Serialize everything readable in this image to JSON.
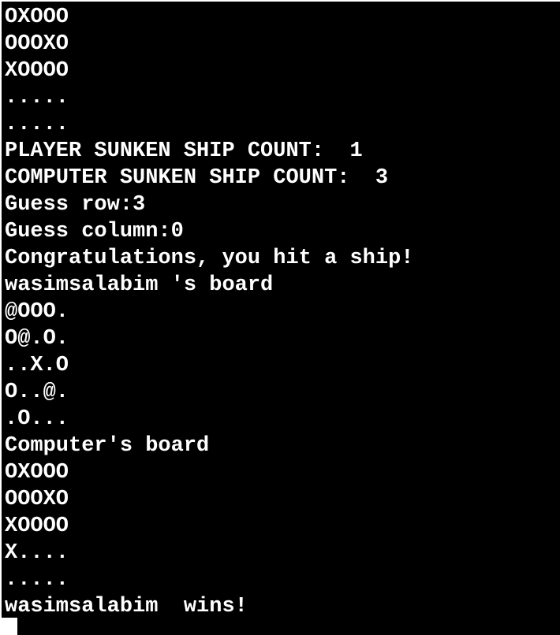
{
  "terminal": {
    "lines": [
      "OXOOO",
      "OOOXO",
      "XOOOO",
      ".....",
      ".....",
      "PLAYER SUNKEN SHIP COUNT:  1",
      "COMPUTER SUNKEN SHIP COUNT:  3",
      "Guess row:3",
      "Guess column:0",
      "Congratulations, you hit a ship!",
      "wasimsalabim 's board",
      "@OOO.",
      "O@.O.",
      "..X.O",
      "O..@.",
      ".O...",
      "Computer's board",
      "OXOOO",
      "OOOXO",
      "XOOOO",
      "X....",
      ".....",
      "wasimsalabim  wins!"
    ]
  }
}
